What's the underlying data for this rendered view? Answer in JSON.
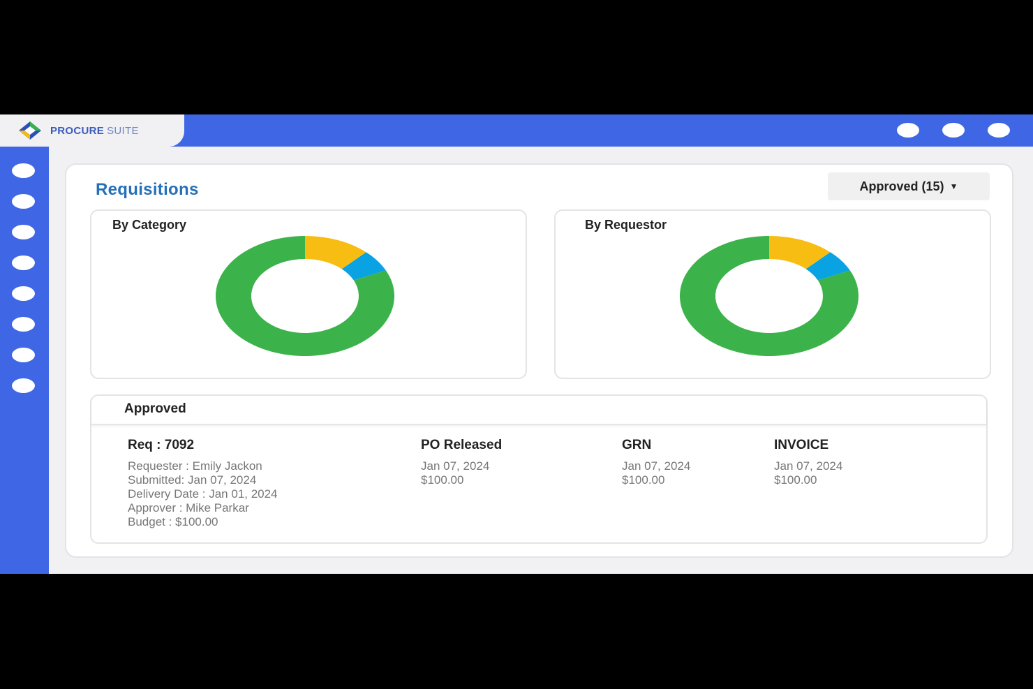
{
  "app": {
    "brand_primary": "PROCURE",
    "brand_secondary": "SUITE",
    "accent_color": "#3f67e5"
  },
  "page": {
    "title": "Requisitions",
    "filter_label": "Approved (15)",
    "filter_icon": "caret-down-icon"
  },
  "charts": {
    "category_title": "By Category",
    "requestor_title": "By Requestor"
  },
  "chart_data": [
    {
      "type": "pie",
      "title": "By Category",
      "values": [
        12,
        6,
        82
      ],
      "colors": [
        "#f7bd12",
        "#09a2e2",
        "#3bb34a"
      ],
      "donut": true
    },
    {
      "type": "pie",
      "title": "By Requestor",
      "values": [
        12,
        6,
        82
      ],
      "colors": [
        "#f7bd12",
        "#09a2e2",
        "#3bb34a"
      ],
      "donut": true
    }
  ],
  "approved": {
    "section_title": "Approved",
    "req": {
      "title": "Req : 7092",
      "requester": "Requester : Emily Jackon",
      "submitted": "Submitted: Jan 07, 2024",
      "delivery": "Delivery Date :  Jan 01, 2024",
      "approver": "Approver : Mike Parkar",
      "budget": "Budget : $100.00"
    },
    "po": {
      "title": "PO Released",
      "date": "Jan 07, 2024",
      "amount": "$100.00"
    },
    "grn": {
      "title": "GRN",
      "date": "Jan 07, 2024",
      "amount": "$100.00"
    },
    "invoice": {
      "title": "INVOICE",
      "date": "Jan 07, 2024",
      "amount": "$100.00"
    }
  }
}
